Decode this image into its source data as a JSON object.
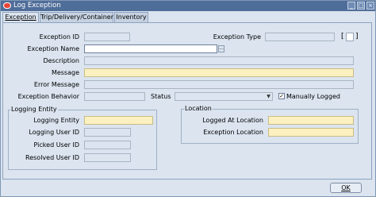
{
  "window": {
    "title": "Log Exception",
    "minimize": "_",
    "maximize": "□",
    "close": "×"
  },
  "tabs": [
    {
      "label": "Exception",
      "active": true
    },
    {
      "label": "Trip/Delivery/Container",
      "active": false
    },
    {
      "label": "Inventory",
      "active": false
    }
  ],
  "form": {
    "exception_id_label": "Exception ID",
    "exception_id_value": "",
    "exception_type_label": "Exception Type",
    "exception_type_value": "",
    "bracket_open": "[",
    "bracket_close": "]",
    "exception_name_label": "Exception Name",
    "exception_name_value": "",
    "lov_button": "...",
    "description_label": "Description",
    "description_value": "",
    "message_label": "Message",
    "message_value": "",
    "error_message_label": "Error Message",
    "error_message_value": "",
    "exception_behavior_label": "Exception Behavior",
    "exception_behavior_value": "",
    "status_label": "Status",
    "status_value": "",
    "manually_logged_label": "Manually Logged",
    "manually_logged_checked": true,
    "check_mark": "✓"
  },
  "logging_entity": {
    "group_label": "Logging Entity",
    "logging_entity_label": "Logging Entity",
    "logging_user_id_label": "Logging User ID",
    "picked_user_id_label": "Picked User ID",
    "resolved_user_id_label": "Resolved User ID"
  },
  "location": {
    "group_label": "Location",
    "logged_at_location_label": "Logged At Location",
    "exception_location_label": "Exception Location"
  },
  "footer": {
    "ok_label": "OK"
  },
  "colors": {
    "title_bar": "#4f6d99",
    "required_field": "#fbf1c0",
    "background": "#dbe4ef"
  }
}
